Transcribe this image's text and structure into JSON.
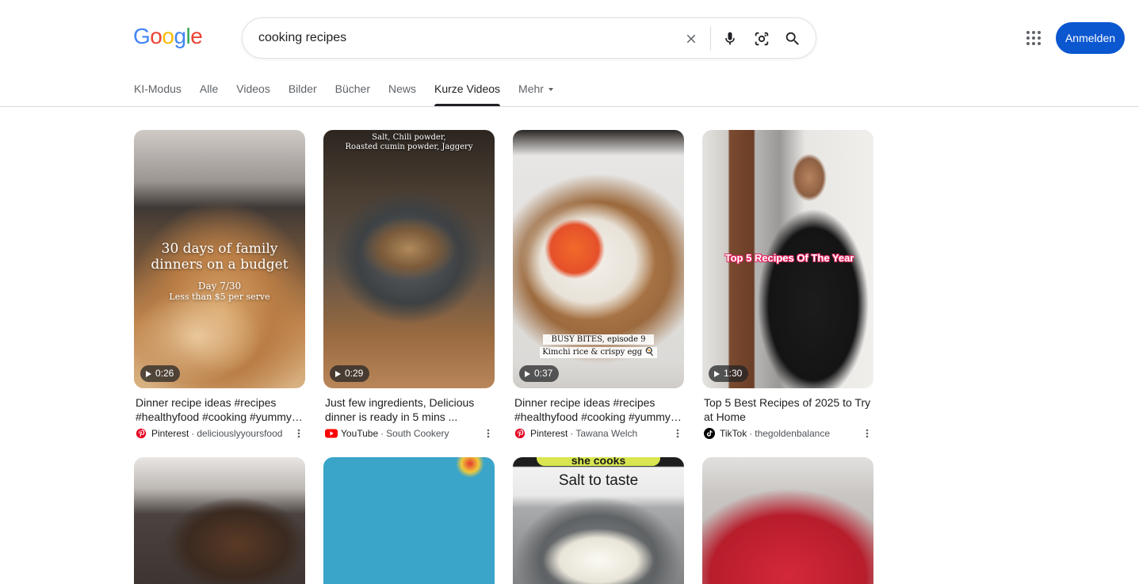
{
  "logo": "Google",
  "search": {
    "query": "cooking recipes"
  },
  "header": {
    "signin_label": "Anmelden"
  },
  "tabs": [
    {
      "label": "KI-Modus"
    },
    {
      "label": "Alle"
    },
    {
      "label": "Videos"
    },
    {
      "label": "Bilder"
    },
    {
      "label": "Bücher"
    },
    {
      "label": "News"
    },
    {
      "label": "Kurze Videos",
      "active": true
    },
    {
      "label": "Mehr"
    }
  ],
  "results": [
    {
      "duration": "0:26",
      "title_line1": "Dinner recipe ideas #recipes",
      "title_line2": "#healthyfood #cooking #yummy…",
      "source": "Pinterest",
      "channel": "deliciouslyyoursfood",
      "source_icon": "pinterest-icon",
      "overlay": {
        "title": "30 days of family dinners on a budget",
        "day": "Day 7/30",
        "note": "Less than $5 per serve"
      }
    },
    {
      "duration": "0:29",
      "title_line1": "Just few ingredients, Delicious",
      "title_line2": "dinner is ready in 5 mins ...",
      "source": "YouTube",
      "channel": "South Cookery",
      "source_icon": "youtube-icon",
      "overlay": {
        "line1": "Salt, Chili powder,",
        "line2": "Roasted cumin powder, Jaggery"
      }
    },
    {
      "duration": "0:37",
      "title_line1": "Dinner recipe ideas #recipes",
      "title_line2": "#healthyfood #cooking #yummy…",
      "source": "Pinterest",
      "channel": "Tawana Welch",
      "source_icon": "pinterest-icon",
      "overlay": {
        "line1": "BUSY BITES, episode 9",
        "line2": "Kimchi rice & crispy egg 🍳"
      }
    },
    {
      "duration": "1:30",
      "title_line1": "Top 5 Best Recipes of 2025 to Try",
      "title_line2": "at Home",
      "source": "TikTok",
      "channel": "thegoldenbalance",
      "source_icon": "tiktok-icon",
      "overlay": {
        "line1": "Top 5 Recipes Of The Year"
      }
    }
  ],
  "row2": [
    {
      "overlay": ""
    },
    {
      "overlay": ""
    },
    {
      "overlay_top": "she cooks",
      "overlay_main": "Salt to taste"
    },
    {
      "overlay": ""
    }
  ],
  "colors": {
    "signin": "#0b57d0",
    "pinterest": "#e60023",
    "youtube": "#ff0000",
    "tiktok": "#000000"
  }
}
